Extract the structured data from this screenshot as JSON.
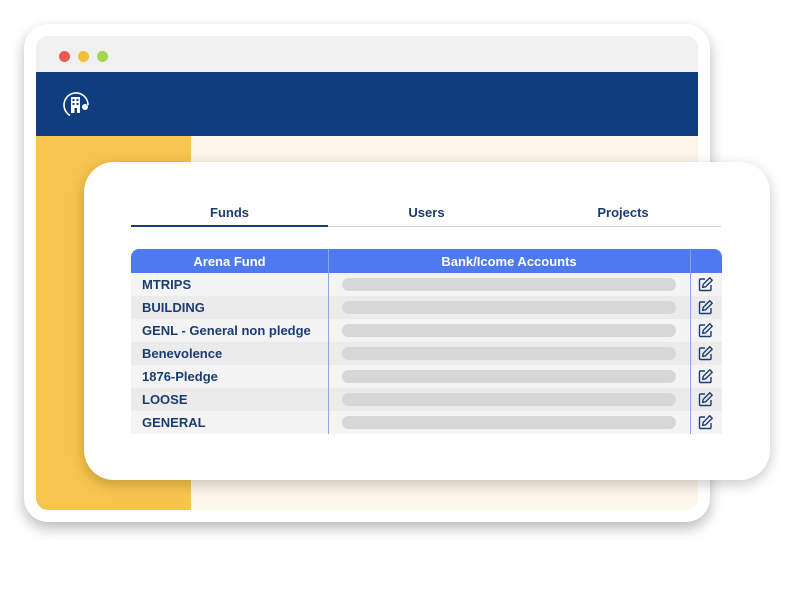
{
  "tabs": [
    {
      "label": "Funds",
      "active": true
    },
    {
      "label": "Users",
      "active": false
    },
    {
      "label": "Projects",
      "active": false
    }
  ],
  "table": {
    "headers": {
      "fund": "Arena Fund",
      "bank": "Bank/Icome Accounts"
    },
    "rows": [
      {
        "fund": "MTRIPS"
      },
      {
        "fund": "BUILDING"
      },
      {
        "fund": "GENL - General non pledge"
      },
      {
        "fund": "Benevolence"
      },
      {
        "fund": "1876-Pledge"
      },
      {
        "fund": "LOOSE"
      },
      {
        "fund": "GENERAL"
      }
    ]
  },
  "icons": {
    "logo": "building-logo-icon",
    "row_action": "edit-icon"
  },
  "colors": {
    "header": "#0f3d7f",
    "sidebar": "#f7c54d",
    "table_header": "#4d7bef",
    "text": "#1b3c72"
  }
}
